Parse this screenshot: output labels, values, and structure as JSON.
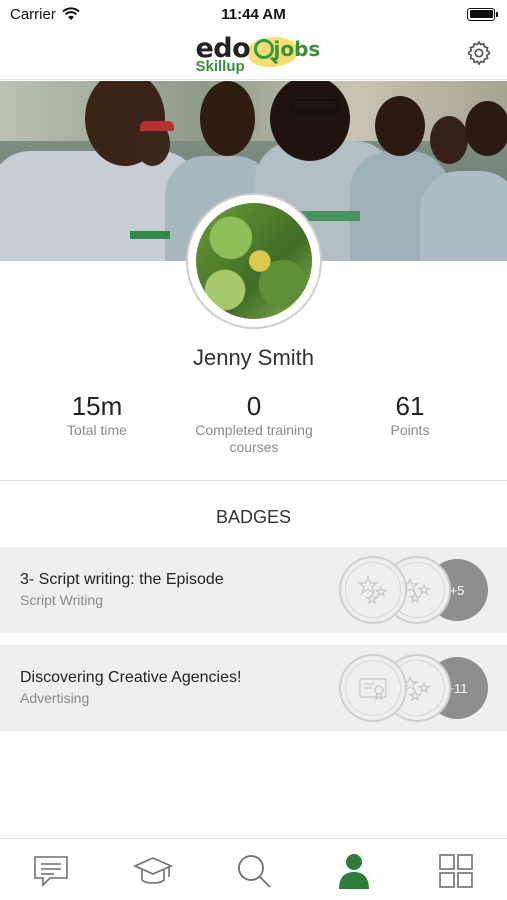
{
  "status_bar": {
    "carrier": "Carrier",
    "time": "11:44 AM"
  },
  "header": {
    "logo": {
      "edo": "edo",
      "jobs": "jobs",
      "skillup": "Skillup"
    },
    "settings_icon": "gear-icon"
  },
  "profile": {
    "name": "Jenny Smith",
    "stats": [
      {
        "value": "15m",
        "label": "Total time"
      },
      {
        "value": "0",
        "label": "Completed training courses"
      },
      {
        "value": "61",
        "label": "Points"
      }
    ]
  },
  "badges": {
    "title": "BADGES",
    "items": [
      {
        "title": "3- Script writing: the Episode",
        "subtitle": "Script Writing",
        "more": "+5",
        "icons": [
          "stars-badge-icon",
          "stars-badge-icon"
        ]
      },
      {
        "title": "Discovering Creative Agencies!",
        "subtitle": "Advertising",
        "more": "+11",
        "icons": [
          "certificate-badge-icon",
          "stars-badge-icon"
        ]
      }
    ]
  },
  "tab_bar": {
    "tabs": [
      {
        "icon": "chat-icon",
        "active": false
      },
      {
        "icon": "graduation-cap-icon",
        "active": false
      },
      {
        "icon": "search-icon",
        "active": false
      },
      {
        "icon": "profile-icon",
        "active": true
      },
      {
        "icon": "grid-icon",
        "active": false
      }
    ]
  },
  "colors": {
    "accent_green": "#2e7d3a",
    "badge_row_bg": "#efefef",
    "more_badge_bg": "#8e8e8e",
    "secondary_text": "#8a8a8a"
  }
}
